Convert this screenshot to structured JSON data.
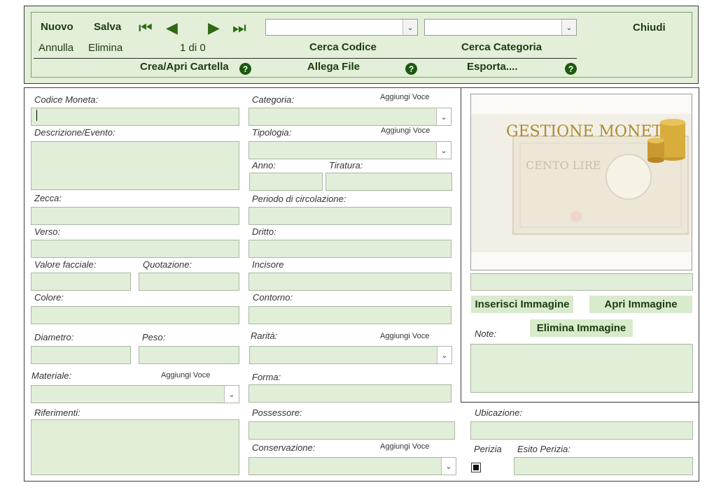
{
  "toolbar": {
    "nuovo": "Nuovo",
    "salva": "Salva",
    "annulla": "Annulla",
    "elimina": "Elimina",
    "record_counter": "1 di 0",
    "cerca_codice": "Cerca Codice",
    "cerca_categoria": "Cerca Categoria",
    "chiudi": "Chiudi",
    "crea_apri_cartella": "Crea/Apri Cartella",
    "allega_file": "Allega File",
    "esporta": "Esporta....",
    "help_glyph": "?",
    "nav_first": "⏮",
    "nav_prev": "◀",
    "nav_next": "▶",
    "nav_last": "⏭"
  },
  "labels": {
    "codice_moneta": "Codice Moneta:",
    "descrizione": "Descrizione/Evento:",
    "zecca": "Zecca:",
    "verso": "Verso:",
    "valore_facciale": "Valore facciale:",
    "quotazione": "Quotazione:",
    "colore": "Colore:",
    "diametro": "Diametro:",
    "peso": "Peso:",
    "materiale": "Materiale:",
    "riferimenti": "Riferimenti:",
    "categoria": "Categoria:",
    "tipologia": "Tipologia:",
    "anno": "Anno:",
    "tiratura": "Tiratura:",
    "periodo": "Periodo di circolazione:",
    "dritto": "Dritto:",
    "incisore": "Incisore",
    "contorno": "Contorno:",
    "rarita": "Rarità:",
    "forma": "Forma:",
    "possessore": "Possessore:",
    "conservazione": "Conservazione:",
    "note": "Note:",
    "ubicazione": "Ubicazione:",
    "perizia": "Perizia",
    "esito_perizia": "Esito Perizia:",
    "aggiungi_voce": "Aggiungi Voce"
  },
  "image_panel": {
    "logo_text": "GESTIONE MONETE",
    "banknote_text": "CENTO LIRE",
    "inserisci": "Inserisci Immagine",
    "apri": "Apri Immagine",
    "elimina": "Elimina Immagine"
  },
  "perizia_checked": true,
  "colors": {
    "accent_green": "#1e3b10",
    "field_bg": "#e1efd9",
    "toolbar_bg": "#e3efd9",
    "icon_green": "#2e6a14"
  }
}
